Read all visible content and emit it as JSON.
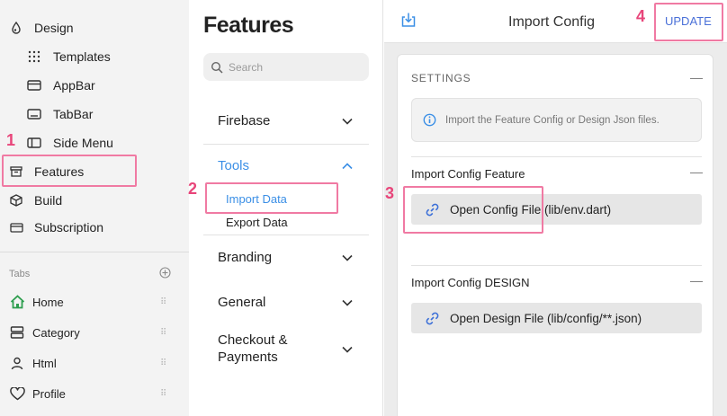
{
  "sidebar": {
    "design": "Design",
    "templates": "Templates",
    "appbar": "AppBar",
    "tabbar": "TabBar",
    "side_menu": "Side Menu",
    "features": "Features",
    "build": "Build",
    "subscription": "Subscription",
    "tabs_label": "Tabs",
    "tabs": [
      {
        "label": "Home",
        "icon": "home-icon"
      },
      {
        "label": "Category",
        "icon": "category-icon"
      },
      {
        "label": "Html",
        "icon": "person-icon"
      },
      {
        "label": "Profile",
        "icon": "heart-icon"
      }
    ]
  },
  "middle": {
    "title": "Features",
    "search_placeholder": "Search",
    "sections": {
      "firebase": "Firebase",
      "tools": "Tools",
      "import_data": "Import Data",
      "export_data": "Export Data",
      "branding": "Branding",
      "general": "General",
      "checkout_line1": "Checkout &",
      "checkout_line2": "Payments"
    }
  },
  "right": {
    "title": "Import Config",
    "update_label": "UPDATE",
    "settings_label": "SETTINGS",
    "info_text": "Import the Feature Config or Design Json files.",
    "feature_heading": "Import Config Feature",
    "open_config_label": "Open Config File (lib/env.dart)",
    "design_heading": "Import Config DESIGN",
    "open_design_label": "Open Design File (lib/config/**.json)",
    "collapse_symbol": "—"
  },
  "annotations": {
    "m1": "1",
    "m2": "2",
    "m3": "3",
    "m4": "4"
  },
  "colors": {
    "accent": "#3b8fe6",
    "update": "#4a70d8",
    "annotation": "#e8457a",
    "sidebar_bg": "#f3f3f3",
    "panel_bg": "#ececec"
  }
}
